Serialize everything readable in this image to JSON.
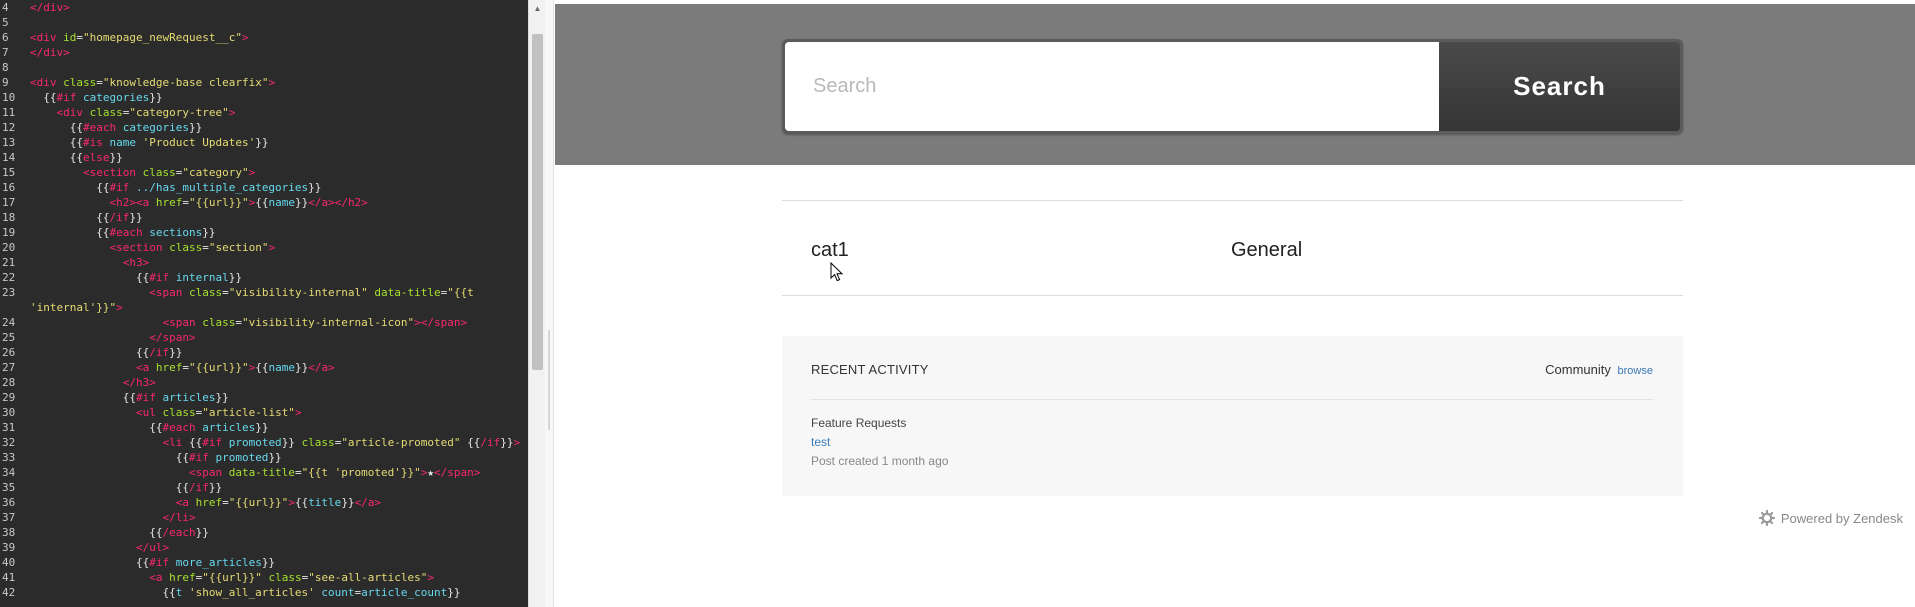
{
  "editor": {
    "lines": [
      {
        "n": "4",
        "indent": "",
        "tokens": [
          [
            "tag",
            "</div>"
          ]
        ]
      },
      {
        "n": "5",
        "indent": "",
        "tokens": []
      },
      {
        "n": "6",
        "indent": "",
        "tokens": [
          [
            "tag",
            "<div "
          ],
          [
            "atn",
            "id"
          ],
          [
            "pun",
            "="
          ],
          [
            "str",
            "\"homepage_newRequest__c\""
          ],
          [
            "tag",
            ">"
          ]
        ]
      },
      {
        "n": "7",
        "indent": "",
        "tokens": [
          [
            "tag",
            "</div>"
          ]
        ]
      },
      {
        "n": "8",
        "indent": "",
        "tokens": []
      },
      {
        "n": "9",
        "indent": "",
        "tokens": [
          [
            "tag",
            "<div "
          ],
          [
            "atn",
            "class"
          ],
          [
            "pun",
            "="
          ],
          [
            "str",
            "\"knowledge-base clearfix\""
          ],
          [
            "tag",
            ">"
          ]
        ]
      },
      {
        "n": "10",
        "indent": "  ",
        "tokens": [
          [
            "pun",
            "{{"
          ],
          [
            "kw",
            "#if"
          ],
          [
            "pl",
            " "
          ],
          [
            "id",
            "categories"
          ],
          [
            "pun",
            "}}"
          ]
        ]
      },
      {
        "n": "11",
        "indent": "    ",
        "tokens": [
          [
            "tag",
            "<div "
          ],
          [
            "atn",
            "class"
          ],
          [
            "pun",
            "="
          ],
          [
            "str",
            "\"category-tree\""
          ],
          [
            "tag",
            ">"
          ]
        ]
      },
      {
        "n": "12",
        "indent": "      ",
        "tokens": [
          [
            "pun",
            "{{"
          ],
          [
            "kw",
            "#each"
          ],
          [
            "pl",
            " "
          ],
          [
            "id",
            "categories"
          ],
          [
            "pun",
            "}}"
          ]
        ]
      },
      {
        "n": "13",
        "indent": "      ",
        "tokens": [
          [
            "pun",
            "{{"
          ],
          [
            "kw",
            "#is"
          ],
          [
            "pl",
            " "
          ],
          [
            "id",
            "name"
          ],
          [
            "pl",
            " "
          ],
          [
            "str",
            "'Product Updates'"
          ],
          [
            "pun",
            "}}"
          ]
        ]
      },
      {
        "n": "14",
        "indent": "      ",
        "tokens": [
          [
            "pun",
            "{{"
          ],
          [
            "kw",
            "else"
          ],
          [
            "pun",
            "}}"
          ]
        ]
      },
      {
        "n": "15",
        "indent": "        ",
        "tokens": [
          [
            "tag",
            "<section "
          ],
          [
            "atn",
            "class"
          ],
          [
            "pun",
            "="
          ],
          [
            "str",
            "\"category\""
          ],
          [
            "tag",
            ">"
          ]
        ]
      },
      {
        "n": "16",
        "indent": "          ",
        "tokens": [
          [
            "pun",
            "{{"
          ],
          [
            "kw",
            "#if"
          ],
          [
            "pl",
            " "
          ],
          [
            "id",
            "../has_multiple_categories"
          ],
          [
            "pun",
            "}}"
          ]
        ]
      },
      {
        "n": "17",
        "indent": "            ",
        "tokens": [
          [
            "tag",
            "<h2><a "
          ],
          [
            "atn",
            "href"
          ],
          [
            "pun",
            "="
          ],
          [
            "str",
            "\"{{url}}\""
          ],
          [
            "tag",
            ">"
          ],
          [
            "pun",
            "{{"
          ],
          [
            "id",
            "name"
          ],
          [
            "pun",
            "}}"
          ],
          [
            "tag",
            "</a></h2>"
          ]
        ]
      },
      {
        "n": "18",
        "indent": "          ",
        "tokens": [
          [
            "pun",
            "{{"
          ],
          [
            "kw",
            "/if"
          ],
          [
            "pun",
            "}}"
          ]
        ]
      },
      {
        "n": "19",
        "indent": "          ",
        "tokens": [
          [
            "pun",
            "{{"
          ],
          [
            "kw",
            "#each"
          ],
          [
            "pl",
            " "
          ],
          [
            "id",
            "sections"
          ],
          [
            "pun",
            "}}"
          ]
        ]
      },
      {
        "n": "20",
        "indent": "            ",
        "tokens": [
          [
            "tag",
            "<section "
          ],
          [
            "atn",
            "class"
          ],
          [
            "pun",
            "="
          ],
          [
            "str",
            "\"section\""
          ],
          [
            "tag",
            ">"
          ]
        ]
      },
      {
        "n": "21",
        "indent": "              ",
        "tokens": [
          [
            "tag",
            "<h3>"
          ]
        ]
      },
      {
        "n": "22",
        "indent": "                ",
        "tokens": [
          [
            "pun",
            "{{"
          ],
          [
            "kw",
            "#if"
          ],
          [
            "pl",
            " "
          ],
          [
            "id",
            "internal"
          ],
          [
            "pun",
            "}}"
          ]
        ]
      },
      {
        "n": "23",
        "indent": "                  ",
        "tokens": [
          [
            "tag",
            "<span "
          ],
          [
            "atn",
            "class"
          ],
          [
            "pun",
            "="
          ],
          [
            "str",
            "\"visibility-internal\""
          ],
          [
            "pl",
            " "
          ],
          [
            "atn",
            "data-title"
          ],
          [
            "pun",
            "="
          ],
          [
            "str",
            "\"{{t"
          ]
        ]
      },
      {
        "n": "",
        "indent": "",
        "tokens": [
          [
            "str",
            "'internal'}}\""
          ],
          [
            "tag",
            ">"
          ]
        ]
      },
      {
        "n": "24",
        "indent": "                    ",
        "tokens": [
          [
            "tag",
            "<span "
          ],
          [
            "atn",
            "class"
          ],
          [
            "pun",
            "="
          ],
          [
            "str",
            "\"visibility-internal-icon\""
          ],
          [
            "tag",
            "></span>"
          ]
        ]
      },
      {
        "n": "25",
        "indent": "                  ",
        "tokens": [
          [
            "tag",
            "</span>"
          ]
        ]
      },
      {
        "n": "26",
        "indent": "                ",
        "tokens": [
          [
            "pun",
            "{{"
          ],
          [
            "kw",
            "/if"
          ],
          [
            "pun",
            "}}"
          ]
        ]
      },
      {
        "n": "27",
        "indent": "                ",
        "tokens": [
          [
            "tag",
            "<a "
          ],
          [
            "atn",
            "href"
          ],
          [
            "pun",
            "="
          ],
          [
            "str",
            "\"{{url}}\""
          ],
          [
            "tag",
            ">"
          ],
          [
            "pun",
            "{{"
          ],
          [
            "id",
            "name"
          ],
          [
            "pun",
            "}}"
          ],
          [
            "tag",
            "</a>"
          ]
        ]
      },
      {
        "n": "28",
        "indent": "              ",
        "tokens": [
          [
            "tag",
            "</h3>"
          ]
        ]
      },
      {
        "n": "29",
        "indent": "              ",
        "tokens": [
          [
            "pun",
            "{{"
          ],
          [
            "kw",
            "#if"
          ],
          [
            "pl",
            " "
          ],
          [
            "id",
            "articles"
          ],
          [
            "pun",
            "}}"
          ]
        ]
      },
      {
        "n": "30",
        "indent": "                ",
        "tokens": [
          [
            "tag",
            "<ul "
          ],
          [
            "atn",
            "class"
          ],
          [
            "pun",
            "="
          ],
          [
            "str",
            "\"article-list\""
          ],
          [
            "tag",
            ">"
          ]
        ]
      },
      {
        "n": "31",
        "indent": "                  ",
        "tokens": [
          [
            "pun",
            "{{"
          ],
          [
            "kw",
            "#each"
          ],
          [
            "pl",
            " "
          ],
          [
            "id",
            "articles"
          ],
          [
            "pun",
            "}}"
          ]
        ]
      },
      {
        "n": "32",
        "indent": "                    ",
        "tokens": [
          [
            "tag",
            "<li "
          ],
          [
            "pun",
            "{{"
          ],
          [
            "kw",
            "#if"
          ],
          [
            "pl",
            " "
          ],
          [
            "id",
            "promoted"
          ],
          [
            "pun",
            "}}"
          ],
          [
            "pl",
            " "
          ],
          [
            "atn",
            "class"
          ],
          [
            "pun",
            "="
          ],
          [
            "str",
            "\"article-promoted\""
          ],
          [
            "pl",
            " "
          ],
          [
            "pun",
            "{{"
          ],
          [
            "kw",
            "/if"
          ],
          [
            "pun",
            "}}"
          ],
          [
            "tag",
            ">"
          ]
        ]
      },
      {
        "n": "33",
        "indent": "                      ",
        "tokens": [
          [
            "pun",
            "{{"
          ],
          [
            "kw",
            "#if"
          ],
          [
            "pl",
            " "
          ],
          [
            "id",
            "promoted"
          ],
          [
            "pun",
            "}}"
          ]
        ]
      },
      {
        "n": "34",
        "indent": "                        ",
        "tokens": [
          [
            "tag",
            "<span "
          ],
          [
            "atn",
            "data-title"
          ],
          [
            "pun",
            "="
          ],
          [
            "str",
            "\"{{t 'promoted'}}\""
          ],
          [
            "tag",
            ">"
          ],
          [
            "pl",
            "★"
          ],
          [
            "tag",
            "</span>"
          ]
        ]
      },
      {
        "n": "35",
        "indent": "                      ",
        "tokens": [
          [
            "pun",
            "{{"
          ],
          [
            "kw",
            "/if"
          ],
          [
            "pun",
            "}}"
          ]
        ]
      },
      {
        "n": "36",
        "indent": "                      ",
        "tokens": [
          [
            "tag",
            "<a "
          ],
          [
            "atn",
            "href"
          ],
          [
            "pun",
            "="
          ],
          [
            "str",
            "\"{{url}}\""
          ],
          [
            "tag",
            ">"
          ],
          [
            "pun",
            "{{"
          ],
          [
            "id",
            "title"
          ],
          [
            "pun",
            "}}"
          ],
          [
            "tag",
            "</a>"
          ]
        ]
      },
      {
        "n": "37",
        "indent": "                    ",
        "tokens": [
          [
            "tag",
            "</li>"
          ]
        ]
      },
      {
        "n": "38",
        "indent": "                  ",
        "tokens": [
          [
            "pun",
            "{{"
          ],
          [
            "kw",
            "/each"
          ],
          [
            "pun",
            "}}"
          ]
        ]
      },
      {
        "n": "39",
        "indent": "                ",
        "tokens": [
          [
            "tag",
            "</ul>"
          ]
        ]
      },
      {
        "n": "40",
        "indent": "                ",
        "tokens": [
          [
            "pun",
            "{{"
          ],
          [
            "kw",
            "#if"
          ],
          [
            "pl",
            " "
          ],
          [
            "id",
            "more_articles"
          ],
          [
            "pun",
            "}}"
          ]
        ]
      },
      {
        "n": "41",
        "indent": "                  ",
        "tokens": [
          [
            "tag",
            "<a "
          ],
          [
            "atn",
            "href"
          ],
          [
            "pun",
            "="
          ],
          [
            "str",
            "\"{{url}}\""
          ],
          [
            "pl",
            " "
          ],
          [
            "atn",
            "class"
          ],
          [
            "pun",
            "="
          ],
          [
            "str",
            "\"see-all-articles\""
          ],
          [
            "tag",
            ">"
          ]
        ]
      },
      {
        "n": "42",
        "indent": "                    ",
        "tokens": [
          [
            "pun",
            "{{"
          ],
          [
            "id",
            "t"
          ],
          [
            "pl",
            " "
          ],
          [
            "str",
            "'show_all_articles'"
          ],
          [
            "pl",
            " "
          ],
          [
            "id",
            "count"
          ],
          [
            "pun",
            "="
          ],
          [
            "id",
            "article_count"
          ],
          [
            "pun",
            "}}"
          ]
        ]
      }
    ]
  },
  "search": {
    "placeholder": "Search",
    "button_label": "Search"
  },
  "categories": [
    {
      "label": "cat1"
    },
    {
      "label": "General"
    }
  ],
  "recent_activity": {
    "title": "RECENT ACTIVITY",
    "community_label": "Community",
    "browse_label": "browse",
    "item": {
      "section": "Feature Requests",
      "link": "test",
      "meta": "Post created 1 month ago"
    }
  },
  "footer": {
    "powered_by": "Powered by Zendesk"
  },
  "colors": {
    "editor_bg": "#2b2b2b",
    "hero_bg": "#7b7b7b",
    "link": "#3a7ab8"
  }
}
